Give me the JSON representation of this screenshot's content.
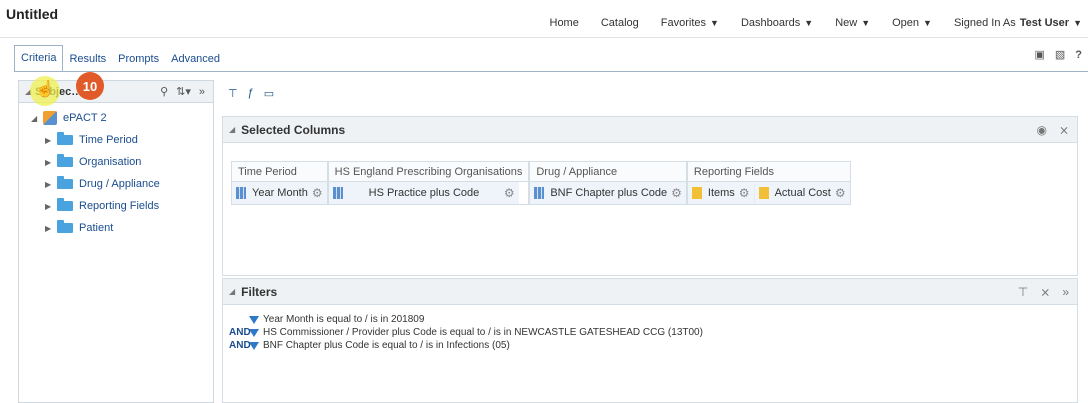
{
  "header": {
    "title": "Untitled",
    "nav": [
      {
        "label": "Home",
        "caret": false
      },
      {
        "label": "Catalog",
        "caret": false
      },
      {
        "label": "Favorites",
        "caret": true
      },
      {
        "label": "Dashboards",
        "caret": true
      },
      {
        "label": "New",
        "caret": true
      },
      {
        "label": "Open",
        "caret": true
      }
    ],
    "signed_in_label": "Signed In As",
    "user": "Test User"
  },
  "tabs": [
    "Criteria",
    "Results",
    "Prompts",
    "Advanced"
  ],
  "step_badge": "10",
  "subject_panel": {
    "title": "Subjec…",
    "root": "ePACT 2",
    "folders": [
      "Time Period",
      "Organisation",
      "Drug / Appliance",
      "Reporting Fields",
      "Patient"
    ]
  },
  "selected_columns": {
    "title": "Selected Columns",
    "groups": [
      {
        "name": "Time Period",
        "columns": [
          {
            "label": "Year Month",
            "icon": "blue"
          }
        ]
      },
      {
        "name": "HS England Prescribing Organisations",
        "columns": [
          {
            "label": "HS Practice plus Code",
            "icon": "blue"
          }
        ]
      },
      {
        "name": "Drug / Appliance",
        "columns": [
          {
            "label": "BNF Chapter plus Code",
            "icon": "blue"
          }
        ]
      },
      {
        "name": "Reporting Fields",
        "columns": [
          {
            "label": "Items",
            "icon": "yellow"
          },
          {
            "label": "Actual Cost",
            "icon": "yellow"
          }
        ]
      }
    ]
  },
  "filters": {
    "title": "Filters",
    "items": [
      {
        "prefix": "",
        "text": "Year Month is equal to / is in  201809"
      },
      {
        "prefix": "AND",
        "text": "HS Commissioner / Provider plus Code is equal to / is in  NEWCASTLE GATESHEAD CCG (13T00)"
      },
      {
        "prefix": "AND",
        "text": "BNF Chapter plus Code is equal to / is in  Infections (05)"
      }
    ]
  }
}
